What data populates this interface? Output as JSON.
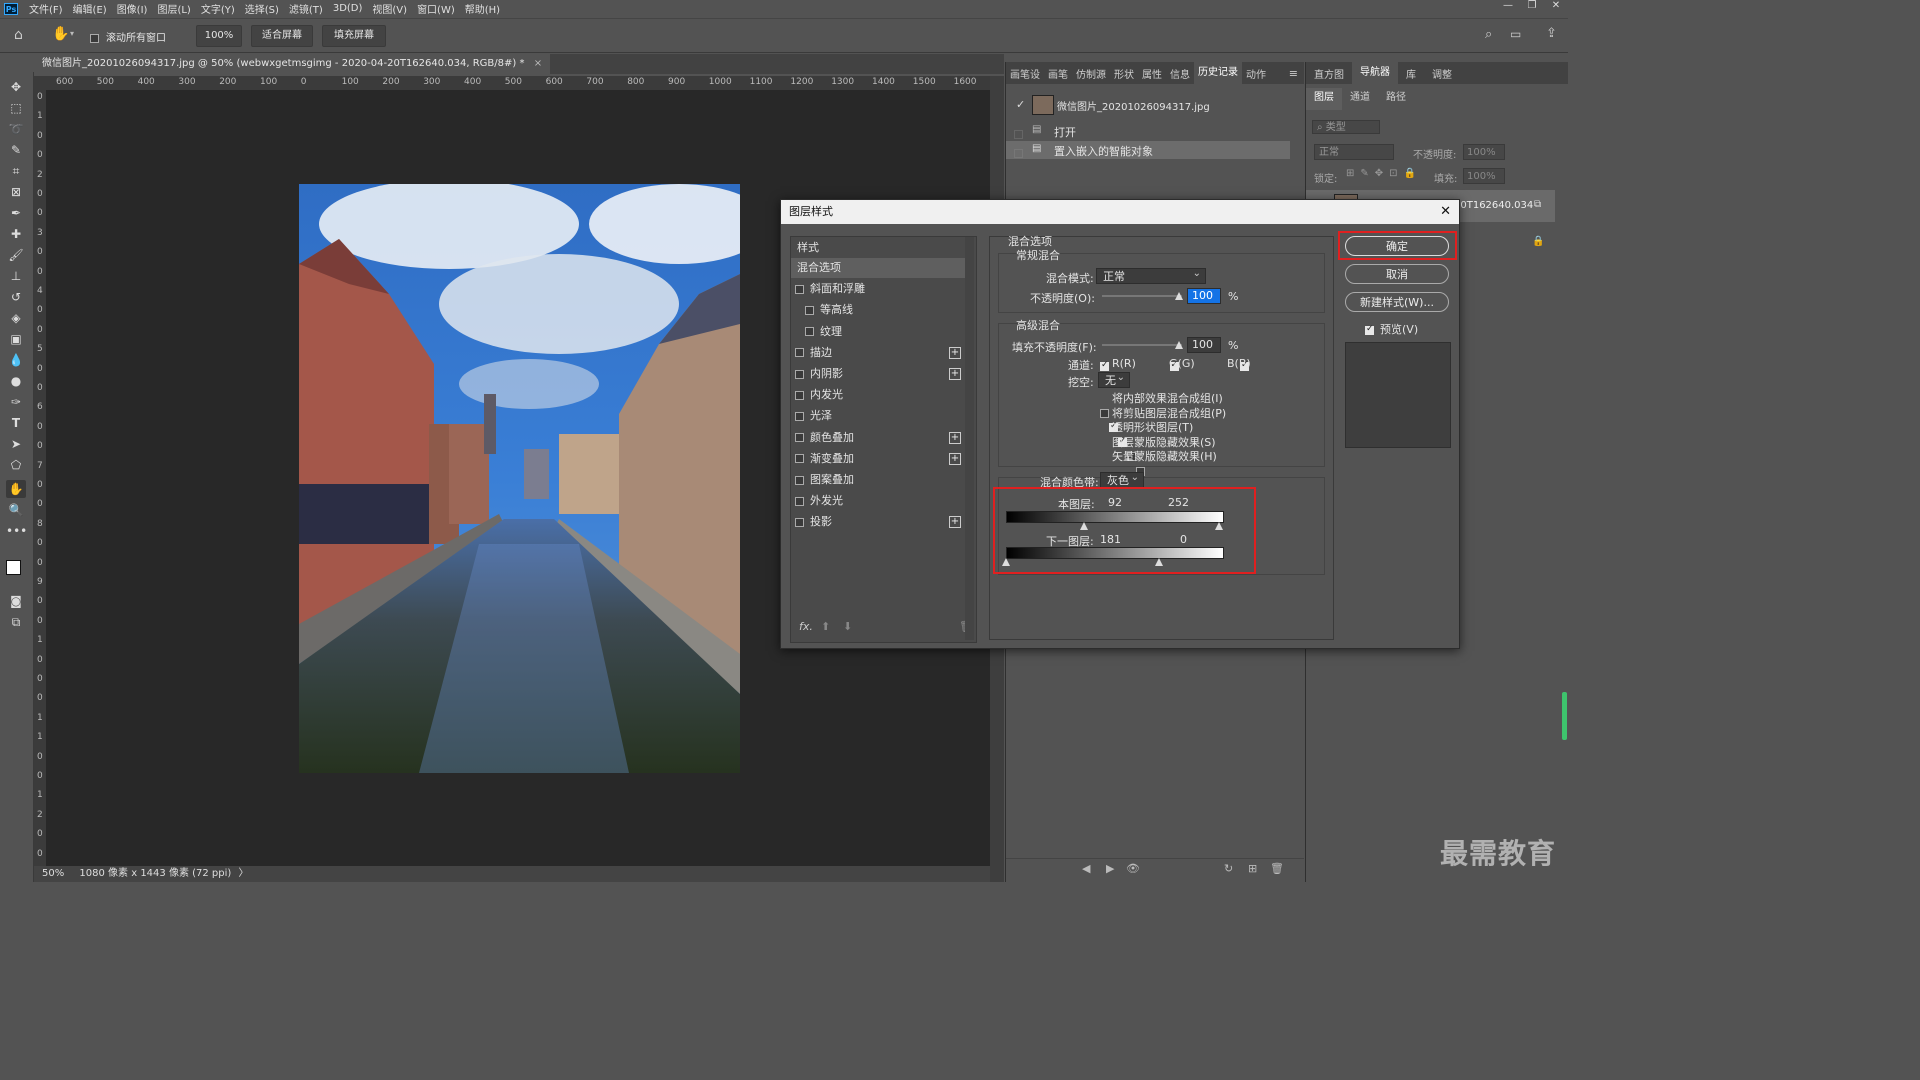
{
  "app": {
    "logo_text": "Ps"
  },
  "menu": [
    "文件(F)",
    "编辑(E)",
    "图像(I)",
    "图层(L)",
    "文字(Y)",
    "选择(S)",
    "滤镜(T)",
    "3D(D)",
    "视图(V)",
    "窗口(W)",
    "帮助(H)"
  ],
  "options_bar": {
    "scroll_all_label": "滚动所有窗口",
    "zoom_button": "100%",
    "fit_screen": "适合屏幕",
    "fill_screen": "填充屏幕"
  },
  "document": {
    "tab_title": "微信图片_20201026094317.jpg @ 50% (webwxgetmsgimg - 2020-04-20T162640.034, RGB/8#) *",
    "tab_close": "×",
    "ruler_labels": [
      "600",
      "500",
      "400",
      "300",
      "200",
      "100",
      "0",
      "100",
      "200",
      "300",
      "400",
      "500",
      "600",
      "700",
      "800",
      "900",
      "1000",
      "1100",
      "1200",
      "1300",
      "1400",
      "1500",
      "1600"
    ],
    "ruler_v_labels": [
      "0",
      "1",
      "0",
      "0",
      "2",
      "0",
      "0",
      "3",
      "0",
      "0",
      "4",
      "0",
      "0",
      "5",
      "0",
      "0",
      "6",
      "0",
      "0",
      "7",
      "0",
      "0",
      "8",
      "0",
      "0",
      "9",
      "0",
      "0",
      "1",
      "0",
      "0",
      "0",
      "1",
      "1",
      "0",
      "0",
      "1",
      "2",
      "0",
      "0"
    ],
    "status_zoom": "50%",
    "status_info": "1080 像素 x 1443 像素 (72 ppi)"
  },
  "history_panel": {
    "tabs": [
      "画笔设",
      "画笔",
      "仿制源",
      "形状",
      "属性",
      "信息",
      "历史记录",
      "动作"
    ],
    "active_tab": "历史记录",
    "snapshot": "微信图片_20201026094317.jpg",
    "items": [
      "打开",
      "置入嵌入的智能对象"
    ]
  },
  "right_panel": {
    "top_tabs": [
      "直方图",
      "导航器",
      "库",
      "调整"
    ],
    "active_top": "导航器",
    "layer_tabs": [
      "图层",
      "通道",
      "路径"
    ],
    "filter_label": "类型",
    "blend": "正常",
    "opacity_label": "不透明度:",
    "opacity": "100%",
    "lock_label": "锁定:",
    "fill_label": "填充:",
    "fill": "100%",
    "layer_name": "20T162640.034"
  },
  "dialog": {
    "title": "图层样式",
    "close": "✕",
    "styles_header": "样式",
    "styles": [
      {
        "label": "混合选项",
        "checkbox": false,
        "plus": false,
        "indent": false,
        "active": true
      },
      {
        "label": "斜面和浮雕",
        "checkbox": true,
        "plus": false,
        "indent": false
      },
      {
        "label": "等高线",
        "checkbox": true,
        "plus": false,
        "indent": true
      },
      {
        "label": "纹理",
        "checkbox": true,
        "plus": false,
        "indent": true
      },
      {
        "label": "描边",
        "checkbox": true,
        "plus": true,
        "indent": false
      },
      {
        "label": "内阴影",
        "checkbox": true,
        "plus": true,
        "indent": false
      },
      {
        "label": "内发光",
        "checkbox": true,
        "plus": false,
        "indent": false
      },
      {
        "label": "光泽",
        "checkbox": true,
        "plus": false,
        "indent": false
      },
      {
        "label": "颜色叠加",
        "checkbox": true,
        "plus": true,
        "indent": false
      },
      {
        "label": "渐变叠加",
        "checkbox": true,
        "plus": true,
        "indent": false
      },
      {
        "label": "图案叠加",
        "checkbox": true,
        "plus": false,
        "indent": false
      },
      {
        "label": "外发光",
        "checkbox": true,
        "plus": false,
        "indent": false
      },
      {
        "label": "投影",
        "checkbox": true,
        "plus": true,
        "indent": false
      }
    ],
    "fx_label": "fx.",
    "blend_options_title": "混合选项",
    "general_blending": "常规混合",
    "blend_mode_label": "混合模式:",
    "blend_mode": "正常",
    "opacity_label": "不透明度(O):",
    "opacity": "100",
    "percent": "%",
    "advanced_blending": "高级混合",
    "fill_opacity_label": "填充不透明度(F):",
    "fill_opacity": "100",
    "channels_label": "通道:",
    "channel_r": "R(R)",
    "channel_g": "G(G)",
    "channel_b": "B(B)",
    "knockout_label": "挖空:",
    "knockout": "无",
    "adv_options": [
      {
        "label": "将内部效果混合成组(I)",
        "checked": false
      },
      {
        "label": "将剪贴图层混合成组(P)",
        "checked": true
      },
      {
        "label": "透明形状图层(T)",
        "checked": true
      },
      {
        "label": "图层蒙版隐藏效果(S)",
        "checked": false
      },
      {
        "label": "矢量蒙版隐藏效果(H)",
        "checked": false
      }
    ],
    "blend_if_label": "混合颜色带:",
    "blend_if": "灰色",
    "this_layer_label": "本图层:",
    "this_layer_low": "92",
    "this_layer_high": "252",
    "underlying_label": "下一图层:",
    "underlying_low": "181",
    "underlying_high": "0",
    "sliders": {
      "this_low": 92,
      "this_high": 252,
      "under_low": 0,
      "under_high": 181,
      "max": 255
    },
    "ok": "确定",
    "cancel": "取消",
    "new_style": "新建样式(W)...",
    "preview": "预览(V)"
  },
  "watermark": "最需教育",
  "colors": {
    "accent_red": "#e02020",
    "highlight": "#1473e6"
  }
}
